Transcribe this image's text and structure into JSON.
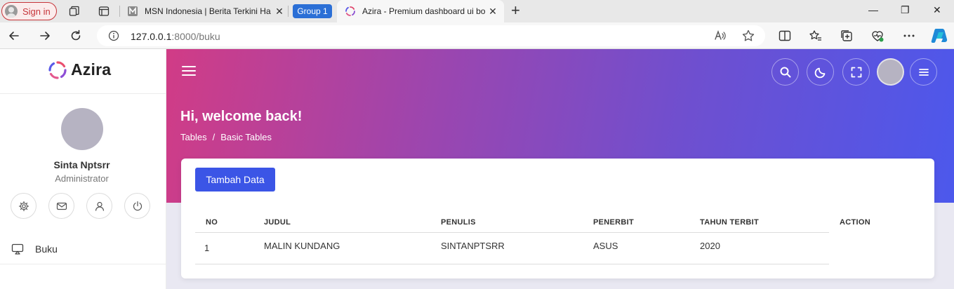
{
  "browser": {
    "signin_label": "Sign in",
    "tabs": [
      {
        "title": "MSN Indonesia | Berita Terkini Ha",
        "close": "✕"
      },
      {
        "title": "Azira - Premium dashboard ui bo",
        "close": "✕"
      }
    ],
    "group_label": "Group 1",
    "new_tab": "+",
    "window_controls": {
      "minimize": "—",
      "maximize": "❐",
      "close": "✕"
    },
    "url_host": "127.0.0.1",
    "url_rest": ":8000/buku"
  },
  "sidebar": {
    "brand": "Azira",
    "user_name": "Sinta Nptsrr",
    "user_role": "Administrator",
    "quick_actions": [
      "gear-icon",
      "mail-icon",
      "user-icon",
      "power-icon"
    ],
    "menu": [
      {
        "label": "Buku",
        "icon": "monitor-icon"
      }
    ]
  },
  "header": {
    "actions": [
      "search-icon",
      "moon-icon",
      "fullscreen-icon",
      "avatar",
      "menu-icon"
    ]
  },
  "page": {
    "greeting": "Hi, welcome back!",
    "breadcrumb": [
      "Tables",
      "/",
      "Basic Tables"
    ]
  },
  "table": {
    "add_button": "Tambah Data",
    "columns": [
      "NO",
      "JUDUL",
      "PENULIS",
      "PENERBIT",
      "TAHUN TERBIT",
      "ACTION"
    ],
    "rows": [
      {
        "no": "1",
        "judul": "MALIN KUNDANG",
        "penulis": "SINTANPTSRR",
        "penerbit": "ASUS",
        "tahun": "2020"
      }
    ]
  },
  "colors": {
    "accent": "#3b55e6",
    "hero_start": "#d13c86",
    "hero_end": "#4c58ec"
  }
}
